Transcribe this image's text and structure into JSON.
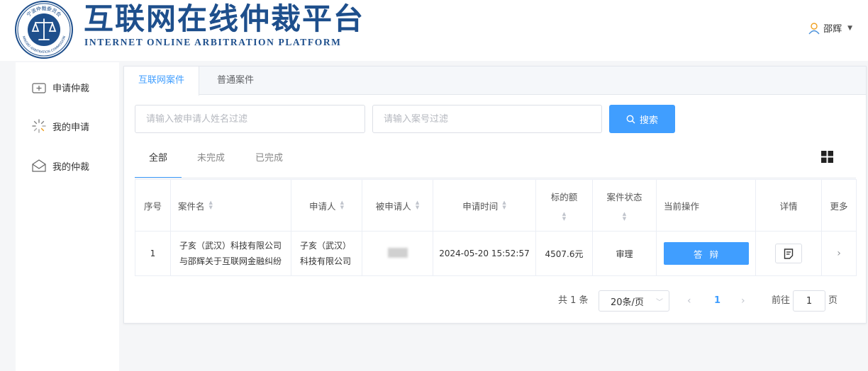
{
  "header": {
    "seal_text_top": "宁波仲裁委员会",
    "seal_text_bottom": "NINGBO ARBITRATION COMMISSION",
    "title_cn": "互联网在线仲裁平台",
    "title_en": "INTERNET ONLINE ARBITRATION PLATFORM",
    "user_name": "邵辉",
    "icons": {
      "user": "user-icon",
      "caret": "caret-down-icon"
    },
    "brand_color": "#1e4f8c"
  },
  "sidebar": {
    "items": [
      {
        "label": "申请仲裁",
        "icon": "plus-box-icon"
      },
      {
        "label": "我的申请",
        "icon": "spinner-icon"
      },
      {
        "label": "我的仲裁",
        "icon": "mail-icon"
      }
    ]
  },
  "top_tabs": [
    {
      "label": "互联网案件",
      "active": true
    },
    {
      "label": "普通案件",
      "active": false
    }
  ],
  "filters": {
    "respondent_placeholder": "请输入被申请人姓名过滤",
    "case_no_placeholder": "请输入案号过滤",
    "search_label": "搜索"
  },
  "status_tabs": [
    {
      "label": "全部",
      "active": true
    },
    {
      "label": "未完成",
      "active": false
    },
    {
      "label": "已完成",
      "active": false
    }
  ],
  "table": {
    "headers": [
      "序号",
      "案件名",
      "申请人",
      "被申请人",
      "申请时间",
      "标的额",
      "案件状态",
      "当前操作",
      "详情",
      "更多"
    ],
    "rows": [
      {
        "index": "1",
        "case_name_line1": "子亥（武汉）科技有限公司",
        "case_name_line2": "与邵辉关于互联网金融纠纷",
        "applicant_line1": "子亥（武汉）",
        "applicant_line2": "科技有限公司",
        "respondent": "",
        "time": "2024-05-20 15:52:57",
        "amount": "4507.6元",
        "status": "审理",
        "action": "答辩"
      }
    ]
  },
  "pagination": {
    "total": "共 1 条",
    "page_size": "20条/页",
    "current_page": "1",
    "goto_prefix": "前往",
    "goto_value": "1",
    "goto_suffix": "页"
  },
  "accent_color": "#409eff"
}
